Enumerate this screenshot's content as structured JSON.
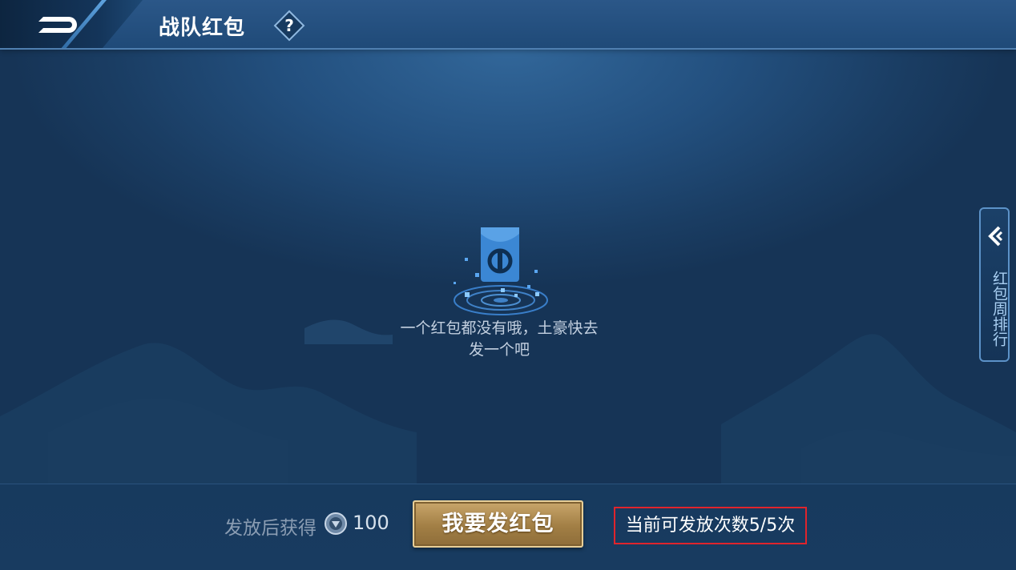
{
  "header": {
    "title": "战队红包",
    "back_icon": "back-arrow-icon",
    "help_label": "?"
  },
  "empty_state": {
    "icon": "red-envelope-icon",
    "line1": "一个红包都没有哦，土豪快去",
    "line2": "发一个吧"
  },
  "side_tab": {
    "icon": "chevron-left-icon",
    "label": "红包周排行"
  },
  "footer": {
    "reward_label": "发放后获得",
    "reward_icon": "coin-icon",
    "reward_amount": "100",
    "send_button_label": "我要发红包",
    "remaining_label": "当前可发放次数5/5次"
  },
  "colors": {
    "accent_gold": "#a27f45",
    "highlight_red": "#e0242c",
    "background_blue": "#1f4a78"
  }
}
